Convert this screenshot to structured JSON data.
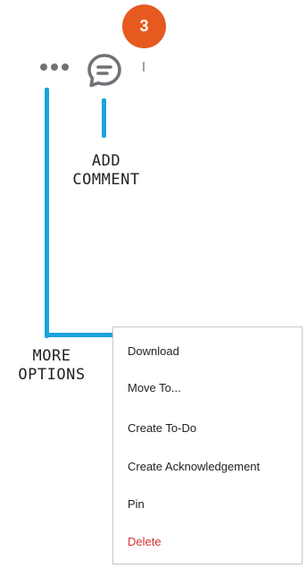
{
  "step_badge": {
    "number": "3",
    "color": "#e65a1f"
  },
  "toolbar": {
    "more_icon": "more-horizontal-icon",
    "comment_icon": "comment-icon"
  },
  "callouts": {
    "comment_label": "ADD\nCOMMENT",
    "more_label": "MORE\nOPTIONS",
    "color": "#1ba3dd"
  },
  "menu": {
    "items": [
      {
        "label": "Download"
      },
      {
        "label": "Move To..."
      },
      {
        "label": "Create To-Do"
      },
      {
        "label": "Create Acknowledgement"
      },
      {
        "label": "Pin"
      },
      {
        "label": "Delete",
        "color": "#d33131"
      }
    ]
  }
}
